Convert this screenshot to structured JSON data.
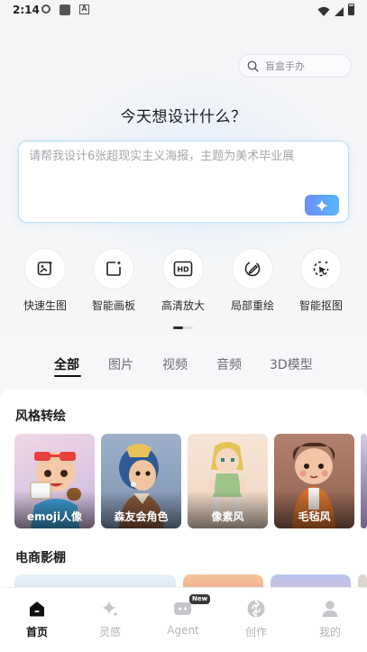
{
  "status_bar": {
    "time": "2:14",
    "a_icon_letter": "A"
  },
  "search": {
    "placeholder": "盲盒手办",
    "icon": "search-icon"
  },
  "headline": "今天想设计什么？",
  "prompt": {
    "placeholder": "请帮我设计6张超现实主义海报，主题为美术毕业展",
    "generate_icon": "sparkle-icon",
    "accent_from": "#6c8dfb",
    "accent_to": "#57b7f7"
  },
  "tools": [
    {
      "label": "快速生图",
      "icon": "quick-image-icon"
    },
    {
      "label": "智能画板",
      "icon": "smart-canvas-icon"
    },
    {
      "label": "高清放大",
      "icon": "hd-upscale-icon"
    },
    {
      "label": "局部重绘",
      "icon": "local-redraw-icon"
    },
    {
      "label": "智能抠图",
      "icon": "smart-cutout-icon"
    }
  ],
  "tabs": [
    "全部",
    "图片",
    "视频",
    "音频",
    "3D模型"
  ],
  "active_tab": 0,
  "sections": {
    "style_transfer": {
      "title": "风格转绘",
      "cards": [
        {
          "caption": "emoji人像"
        },
        {
          "caption": "森友会角色"
        },
        {
          "caption": "像素风"
        },
        {
          "caption": "毛毡风"
        }
      ]
    },
    "ecommerce": {
      "title": "电商影棚"
    }
  },
  "bottom_nav": [
    {
      "label": "首页",
      "icon": "home-icon",
      "active": true
    },
    {
      "label": "灵感",
      "icon": "inspiration-icon",
      "active": false
    },
    {
      "label": "Agent",
      "icon": "agent-icon",
      "active": false,
      "badge": "New"
    },
    {
      "label": "创作",
      "icon": "create-icon",
      "active": false
    },
    {
      "label": "我的",
      "icon": "profile-icon",
      "active": false
    }
  ]
}
